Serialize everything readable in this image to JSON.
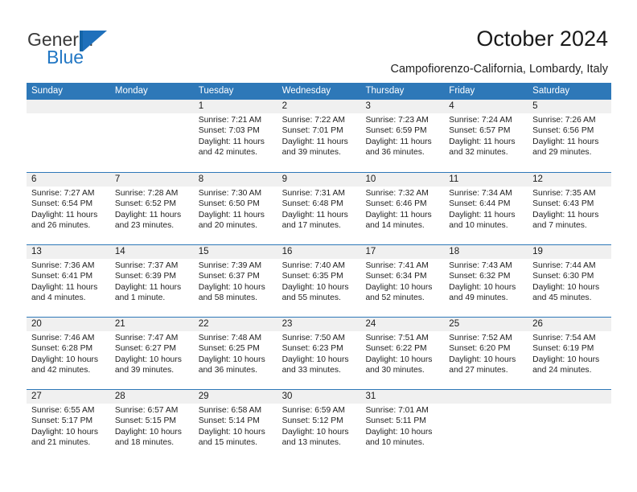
{
  "brand": {
    "name_part1": "General",
    "name_part2": "Blue",
    "mark_icon": "triangle-flag-icon"
  },
  "header": {
    "title": "October 2024",
    "subtitle": "Campofiorenzo-California, Lombardy, Italy"
  },
  "colors": {
    "header_blue": "#2e78b8",
    "brand_blue": "#2277c4",
    "date_band": "#f0f0f0"
  },
  "calendar": {
    "day_headers": [
      "Sunday",
      "Monday",
      "Tuesday",
      "Wednesday",
      "Thursday",
      "Friday",
      "Saturday"
    ],
    "weeks": [
      [
        {
          "day": "",
          "sunrise": "",
          "sunset": "",
          "daylight": ""
        },
        {
          "day": "",
          "sunrise": "",
          "sunset": "",
          "daylight": ""
        },
        {
          "day": "1",
          "sunrise": "Sunrise: 7:21 AM",
          "sunset": "Sunset: 7:03 PM",
          "daylight": "Daylight: 11 hours and 42 minutes."
        },
        {
          "day": "2",
          "sunrise": "Sunrise: 7:22 AM",
          "sunset": "Sunset: 7:01 PM",
          "daylight": "Daylight: 11 hours and 39 minutes."
        },
        {
          "day": "3",
          "sunrise": "Sunrise: 7:23 AM",
          "sunset": "Sunset: 6:59 PM",
          "daylight": "Daylight: 11 hours and 36 minutes."
        },
        {
          "day": "4",
          "sunrise": "Sunrise: 7:24 AM",
          "sunset": "Sunset: 6:57 PM",
          "daylight": "Daylight: 11 hours and 32 minutes."
        },
        {
          "day": "5",
          "sunrise": "Sunrise: 7:26 AM",
          "sunset": "Sunset: 6:56 PM",
          "daylight": "Daylight: 11 hours and 29 minutes."
        }
      ],
      [
        {
          "day": "6",
          "sunrise": "Sunrise: 7:27 AM",
          "sunset": "Sunset: 6:54 PM",
          "daylight": "Daylight: 11 hours and 26 minutes."
        },
        {
          "day": "7",
          "sunrise": "Sunrise: 7:28 AM",
          "sunset": "Sunset: 6:52 PM",
          "daylight": "Daylight: 11 hours and 23 minutes."
        },
        {
          "day": "8",
          "sunrise": "Sunrise: 7:30 AM",
          "sunset": "Sunset: 6:50 PM",
          "daylight": "Daylight: 11 hours and 20 minutes."
        },
        {
          "day": "9",
          "sunrise": "Sunrise: 7:31 AM",
          "sunset": "Sunset: 6:48 PM",
          "daylight": "Daylight: 11 hours and 17 minutes."
        },
        {
          "day": "10",
          "sunrise": "Sunrise: 7:32 AM",
          "sunset": "Sunset: 6:46 PM",
          "daylight": "Daylight: 11 hours and 14 minutes."
        },
        {
          "day": "11",
          "sunrise": "Sunrise: 7:34 AM",
          "sunset": "Sunset: 6:44 PM",
          "daylight": "Daylight: 11 hours and 10 minutes."
        },
        {
          "day": "12",
          "sunrise": "Sunrise: 7:35 AM",
          "sunset": "Sunset: 6:43 PM",
          "daylight": "Daylight: 11 hours and 7 minutes."
        }
      ],
      [
        {
          "day": "13",
          "sunrise": "Sunrise: 7:36 AM",
          "sunset": "Sunset: 6:41 PM",
          "daylight": "Daylight: 11 hours and 4 minutes."
        },
        {
          "day": "14",
          "sunrise": "Sunrise: 7:37 AM",
          "sunset": "Sunset: 6:39 PM",
          "daylight": "Daylight: 11 hours and 1 minute."
        },
        {
          "day": "15",
          "sunrise": "Sunrise: 7:39 AM",
          "sunset": "Sunset: 6:37 PM",
          "daylight": "Daylight: 10 hours and 58 minutes."
        },
        {
          "day": "16",
          "sunrise": "Sunrise: 7:40 AM",
          "sunset": "Sunset: 6:35 PM",
          "daylight": "Daylight: 10 hours and 55 minutes."
        },
        {
          "day": "17",
          "sunrise": "Sunrise: 7:41 AM",
          "sunset": "Sunset: 6:34 PM",
          "daylight": "Daylight: 10 hours and 52 minutes."
        },
        {
          "day": "18",
          "sunrise": "Sunrise: 7:43 AM",
          "sunset": "Sunset: 6:32 PM",
          "daylight": "Daylight: 10 hours and 49 minutes."
        },
        {
          "day": "19",
          "sunrise": "Sunrise: 7:44 AM",
          "sunset": "Sunset: 6:30 PM",
          "daylight": "Daylight: 10 hours and 45 minutes."
        }
      ],
      [
        {
          "day": "20",
          "sunrise": "Sunrise: 7:46 AM",
          "sunset": "Sunset: 6:28 PM",
          "daylight": "Daylight: 10 hours and 42 minutes."
        },
        {
          "day": "21",
          "sunrise": "Sunrise: 7:47 AM",
          "sunset": "Sunset: 6:27 PM",
          "daylight": "Daylight: 10 hours and 39 minutes."
        },
        {
          "day": "22",
          "sunrise": "Sunrise: 7:48 AM",
          "sunset": "Sunset: 6:25 PM",
          "daylight": "Daylight: 10 hours and 36 minutes."
        },
        {
          "day": "23",
          "sunrise": "Sunrise: 7:50 AM",
          "sunset": "Sunset: 6:23 PM",
          "daylight": "Daylight: 10 hours and 33 minutes."
        },
        {
          "day": "24",
          "sunrise": "Sunrise: 7:51 AM",
          "sunset": "Sunset: 6:22 PM",
          "daylight": "Daylight: 10 hours and 30 minutes."
        },
        {
          "day": "25",
          "sunrise": "Sunrise: 7:52 AM",
          "sunset": "Sunset: 6:20 PM",
          "daylight": "Daylight: 10 hours and 27 minutes."
        },
        {
          "day": "26",
          "sunrise": "Sunrise: 7:54 AM",
          "sunset": "Sunset: 6:19 PM",
          "daylight": "Daylight: 10 hours and 24 minutes."
        }
      ],
      [
        {
          "day": "27",
          "sunrise": "Sunrise: 6:55 AM",
          "sunset": "Sunset: 5:17 PM",
          "daylight": "Daylight: 10 hours and 21 minutes."
        },
        {
          "day": "28",
          "sunrise": "Sunrise: 6:57 AM",
          "sunset": "Sunset: 5:15 PM",
          "daylight": "Daylight: 10 hours and 18 minutes."
        },
        {
          "day": "29",
          "sunrise": "Sunrise: 6:58 AM",
          "sunset": "Sunset: 5:14 PM",
          "daylight": "Daylight: 10 hours and 15 minutes."
        },
        {
          "day": "30",
          "sunrise": "Sunrise: 6:59 AM",
          "sunset": "Sunset: 5:12 PM",
          "daylight": "Daylight: 10 hours and 13 minutes."
        },
        {
          "day": "31",
          "sunrise": "Sunrise: 7:01 AM",
          "sunset": "Sunset: 5:11 PM",
          "daylight": "Daylight: 10 hours and 10 minutes."
        },
        {
          "day": "",
          "sunrise": "",
          "sunset": "",
          "daylight": ""
        },
        {
          "day": "",
          "sunrise": "",
          "sunset": "",
          "daylight": ""
        }
      ]
    ]
  }
}
